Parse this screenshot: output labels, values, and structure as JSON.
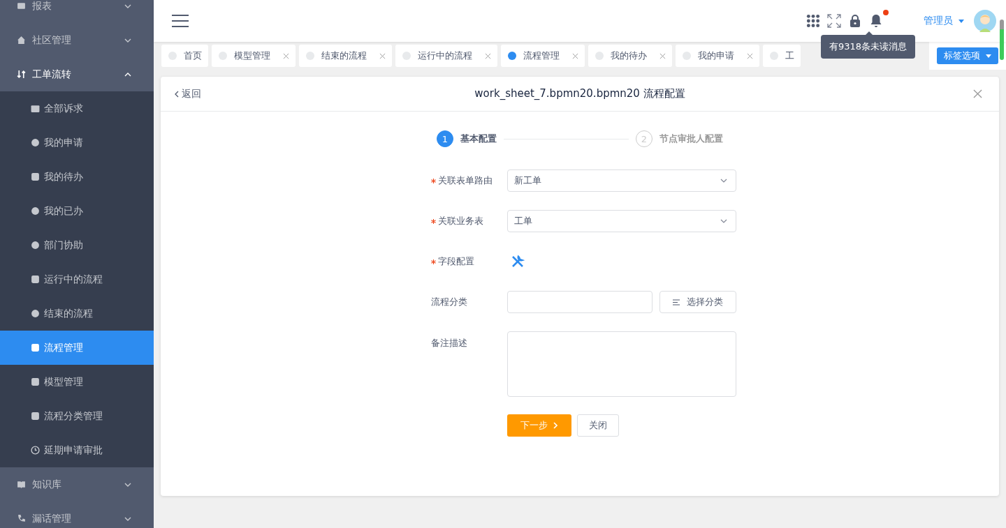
{
  "sidebar": {
    "items": [
      {
        "label": "报表",
        "expanded": false,
        "selected": false
      },
      {
        "label": "社区管理",
        "expanded": false,
        "selected": false
      },
      {
        "label": "工单流转",
        "expanded": true,
        "selected": false,
        "children": [
          {
            "label": "全部诉求",
            "selected": false
          },
          {
            "label": "我的申请",
            "selected": false
          },
          {
            "label": "我的待办",
            "selected": false
          },
          {
            "label": "我的已办",
            "selected": false
          },
          {
            "label": "部门协助",
            "selected": false
          },
          {
            "label": "运行中的流程",
            "selected": false
          },
          {
            "label": "结束的流程",
            "selected": false
          },
          {
            "label": "流程管理",
            "selected": true
          },
          {
            "label": "模型管理",
            "selected": false
          },
          {
            "label": "流程分类管理",
            "selected": false
          },
          {
            "label": "延期申请审批",
            "selected": false
          }
        ]
      },
      {
        "label": "知识库",
        "expanded": false,
        "selected": false
      },
      {
        "label": "漏话管理",
        "expanded": false,
        "selected": false
      }
    ]
  },
  "header": {
    "user": "管理员",
    "has_unread": true,
    "tooltip": "有9318条未读消息"
  },
  "tabs": [
    {
      "label": "首页",
      "selected": false,
      "closable": false
    },
    {
      "label": "模型管理",
      "selected": false,
      "closable": true
    },
    {
      "label": "结束的流程",
      "selected": false,
      "closable": true
    },
    {
      "label": "运行中的流程",
      "selected": false,
      "closable": true
    },
    {
      "label": "流程管理",
      "selected": true,
      "closable": true
    },
    {
      "label": "我的待办",
      "selected": false,
      "closable": true
    },
    {
      "label": "我的申请",
      "selected": false,
      "closable": true
    },
    {
      "label": "工",
      "selected": false,
      "closable": false
    }
  ],
  "tab_options": "标签选项",
  "panel": {
    "back": "返回",
    "title": "work_sheet_7.bpmn20.bpmn20 流程配置",
    "steps": [
      {
        "number": "1",
        "label": "基本配置",
        "active": true
      },
      {
        "number": "2",
        "label": "节点审批人配置",
        "active": false
      }
    ],
    "fields": [
      {
        "kind": "select",
        "label": "关联表单路由",
        "required": true,
        "value": "新工单"
      },
      {
        "kind": "select",
        "label": "关联业务表",
        "required": true,
        "value": "工单"
      },
      {
        "kind": "tool",
        "label": "字段配置",
        "required": true
      },
      {
        "kind": "input_button",
        "label": "流程分类",
        "required": false,
        "button": "选择分类"
      },
      {
        "kind": "textarea",
        "label": "备注描述",
        "required": false
      }
    ],
    "next": "下一步",
    "close": "关闭"
  }
}
